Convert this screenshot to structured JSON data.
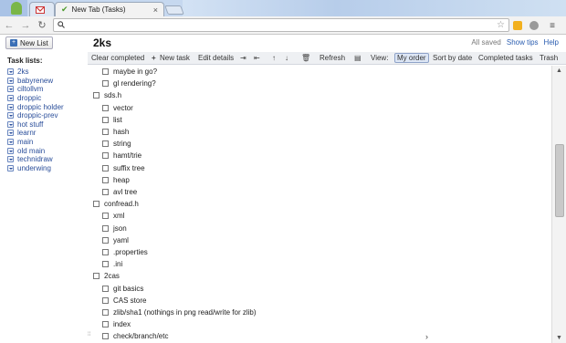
{
  "browser": {
    "tab_gmail_icon": "gmail-icon",
    "tab_title": "New Tab (Tasks)",
    "tab_close": "×",
    "address_placeholder": "",
    "icons": {
      "back": "back-arrow-icon",
      "forward": "forward-arrow-icon",
      "reload": "reload-icon",
      "search": "search-icon",
      "star": "star-icon",
      "menu": "menu-icon"
    }
  },
  "app": {
    "new_list_label": "New List",
    "list_title": "2ks",
    "status": "All saved",
    "show_tips": "Show tips",
    "help": "Help"
  },
  "sidebar": {
    "heading": "Task lists:",
    "lists": [
      "2ks",
      "babyrenew",
      "ciltollvm",
      "droppic",
      "droppic holder",
      "droppic-prev",
      "hot stuff",
      "learnr",
      "main",
      "old main",
      "technidraw",
      "underwing"
    ]
  },
  "actions": {
    "clear_completed": "Clear completed",
    "new_task": "New task",
    "edit_details": "Edit details",
    "refresh": "Refresh",
    "view": "View:",
    "my_order": "My order",
    "sort_by_date": "Sort by date",
    "completed_tasks": "Completed tasks",
    "trash": "Trash"
  },
  "tasks": [
    {
      "text": "maybe in go?",
      "level": 1
    },
    {
      "text": "gl rendering?",
      "level": 1
    },
    {
      "text": "sds.h",
      "level": 0
    },
    {
      "text": "vector",
      "level": 1
    },
    {
      "text": "list",
      "level": 1
    },
    {
      "text": "hash",
      "level": 1
    },
    {
      "text": "string",
      "level": 1
    },
    {
      "text": "hamt/trie",
      "level": 1
    },
    {
      "text": "suffix tree",
      "level": 1
    },
    {
      "text": "heap",
      "level": 1
    },
    {
      "text": "avl tree",
      "level": 1
    },
    {
      "text": "confread.h",
      "level": 0
    },
    {
      "text": "xml",
      "level": 1
    },
    {
      "text": "json",
      "level": 1
    },
    {
      "text": "yaml",
      "level": 1
    },
    {
      "text": ".properties",
      "level": 1
    },
    {
      "text": ".ini",
      "level": 1
    },
    {
      "text": "2cas",
      "level": 0
    },
    {
      "text": "git basics",
      "level": 1
    },
    {
      "text": "CAS store",
      "level": 1
    },
    {
      "text": "zlib/sha1 (nothings in png read/write for zlib)",
      "level": 1
    },
    {
      "text": "index",
      "level": 1
    },
    {
      "text": "check/branch/etc",
      "level": 1
    }
  ]
}
